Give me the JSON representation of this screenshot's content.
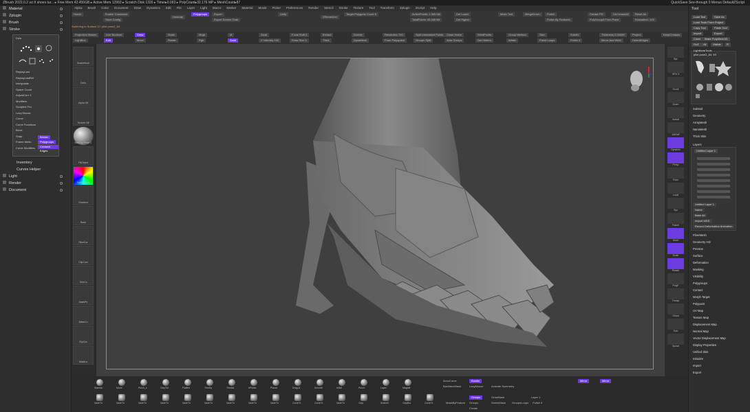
{
  "titlebar": {
    "text": "ZBrush 2022.0.2   sci fi shoes tur...   ▸ Free Mem 42.456GB ▸ Active Mem 12993 ▸ Scratch Disk 1326 ▸ Timer▸0.063 ▸ PolyCount▸32.176 MP ▸ MeshCount▸87",
    "right": "QuickSave   See-through 0   Menus   DefaultZScript"
  },
  "menubar": [
    "Alpha",
    "Brush",
    "Color",
    "Document",
    "Draw",
    "Dynamics",
    "Edit",
    "File",
    "Layer",
    "Light",
    "Macro",
    "Marker",
    "Material",
    "Movie",
    "Picker",
    "Preferences",
    "Render",
    "Stencil",
    "Stroke",
    "Texture",
    "Tool",
    "Transform",
    "Zplugin",
    "Zscript",
    "Help"
  ],
  "leftpanel": {
    "items": [
      {
        "label": "Material"
      },
      {
        "label": "Zplugin"
      },
      {
        "label": "Brush"
      },
      {
        "label": "Stroke"
      },
      {
        "label": "Inventory"
      },
      {
        "label": "Curves Helper"
      },
      {
        "label": "Light"
      },
      {
        "label": "Render"
      },
      {
        "label": "Document"
      }
    ]
  },
  "strokepanel": {
    "dots_label": "Dots",
    "strokes": [
      "Dots",
      "DragRect",
      "FreeHand",
      "DragDot",
      "Spray",
      "Color Spray",
      "Rect"
    ],
    "rows": [
      "ReplayLast",
      "ReplayLastRel",
      "Interpolate",
      "Space Count",
      "AdjustCurv 1",
      "Modifiers",
      "Sculptris Pro",
      "Lazy Mouse",
      "Curve",
      "Curve Functions",
      "Bend",
      "Snap",
      "Frame Mesh",
      "Curve Modifiers"
    ],
    "purple_buttons": [
      "Border",
      "Polygroups",
      "Creased Edges"
    ]
  },
  "topshelf": {
    "row1": [
      "Home",
      "Enable Customize",
      "Store Config",
      "Unsmap",
      "Polygroups",
      "Export",
      "Export Screen Grab",
      "Unify",
      "ZRemesher",
      "Target Polygons Count 5",
      "ActivePoints: 1.365 Mil",
      "TotalPoints: 40.265 Mil",
      "Del Lower",
      "Del Higher",
      "Mesh Tool",
      "MergeDown",
      "Polish",
      "Polish By Features",
      "Crease PG",
      "UnCreaseAll",
      "PolyGroupIt From Paint",
      "Reset All",
      "Evaluation -100"
    ],
    "row2": [
      "Switching to Subtool 17:  pilot pose2_64",
      "Projection Master",
      "LightBox",
      "Live Boolean",
      "Edit",
      "Draw",
      "Move",
      "Scale",
      "Rotate",
      "Mrgb",
      "Rgb",
      "M",
      "Zadd",
      "Zsub",
      "Z Intensity 100",
      "Focal Shift 0",
      "Draw Size 5",
      "Extract",
      "Thick",
      "Double",
      "DynaMesh",
      "Resolution 720",
      "From Polyspaint",
      "Split Unmasked Points",
      "Groups Split",
      "Close Holes",
      "Auto Groups",
      "WeldPoints",
      "Del Hidden",
      "Group Method",
      "Inflate",
      "Size",
      "Panel Loops",
      "Subdiv",
      "Polish 0",
      "Thickness 0.00059",
      "Mirror And Weld",
      "Project",
      "DetectEdges",
      "KeepCreases"
    ]
  },
  "leftshelf": [
    "SnakeHook",
    "Defo",
    "Alpha Off",
    "Texture Off",
    "MatCap Pearl C",
    "FillObject",
    "SwitchColor",
    "Gradient",
    "Back",
    "SliceCur",
    "ClipCurv",
    "TrimCu",
    "MaskPe",
    "MaskCu",
    "ClipCirc",
    "MaskLa"
  ],
  "rightshelf": [
    "Bpr",
    "SPix 3",
    "Scroll",
    "Zoom",
    "Actual",
    "AAHalf",
    "Dynamic",
    "Persp",
    "Floor",
    "Local",
    "Xyz",
    "Frame",
    "Move",
    "Scale",
    "Rotate",
    "PolyF",
    "Transp",
    "Ghost",
    "Solo",
    "Xpose"
  ],
  "rightpanel": {
    "title": "Tool",
    "buttons": [
      "Load Tool",
      "Save As",
      "Load Tools From Project",
      "Copy Tool",
      "Paste Tool",
      "Import",
      "Export",
      "Clone",
      "Make PolyMesh3D",
      "GoZ",
      "All",
      "Visible",
      "R"
    ],
    "lightbox_label": "Lightbox▸Tools",
    "tool_name": "pilot pose2_64. 49",
    "tool_thumbs": [
      "SimpleBrush",
      "Cylinder3D",
      "PolyMesh3D",
      "pilot pose2_64",
      "Merger",
      "Merger",
      "Sphere3D",
      "Merger",
      "pilot p"
    ],
    "menu_items": [
      "Subtool",
      "Geometry",
      "ArrayMesh",
      "NanoMesh",
      "Thick Skin",
      "Layers",
      "FiberMesh",
      "Geometry HD",
      "Preview",
      "Surface",
      "Deformation",
      "Masking",
      "Visibility",
      "Polygroups",
      "Contact",
      "Morph Target",
      "Polypaint",
      "UV Map",
      "Texture Map",
      "Displacement Map",
      "Normal Map",
      "Vector Displacement Map",
      "Display Properties",
      "Unified Skin",
      "Initialize",
      "Import",
      "Export"
    ],
    "layers": {
      "active": "Untitled Layer 1",
      "count": 8,
      "footer": [
        "Untitled Layer 1",
        "Name",
        "Bake All",
        "Import MDD",
        "Record Deformation Animation"
      ]
    }
  },
  "bottomshelf": {
    "brushes_row1": [
      "Standar",
      "Move",
      "Pinch_c",
      "ClayTul",
      "Flatten",
      "TrimDy",
      "TrimAd",
      "hPolish",
      "Planar",
      "Drag-A",
      "Smooth",
      "Inflat",
      "Pinch",
      "Layer",
      "Magnifi"
    ],
    "brushes_row2": [
      "NashTu",
      "NashTu",
      "NashTu",
      "NashTu",
      "NashTu",
      "NashTu",
      "NashTu",
      "NashTu",
      "NashTu",
      "CurveTr",
      "CurveTr",
      "NashTu",
      "Clay",
      "Snakeh",
      "ClayBui",
      "CurveTr"
    ],
    "controls": [
      "AccuCurve",
      "BackfaceMask",
      "LazyMouse",
      "Activate Symmetry",
      "MaskByFeature",
      "Groups",
      "Create",
      "GrowMask",
      "ShrinkMask",
      "GroupsLoops",
      "Layer 1",
      "Polish 0",
      "Mirror",
      "Mirror",
      "Groups",
      "Border"
    ]
  },
  "colors": {
    "accent": "#6d3ce0",
    "panel": "#2e2e2e",
    "viewport": "#3f3f3f"
  }
}
